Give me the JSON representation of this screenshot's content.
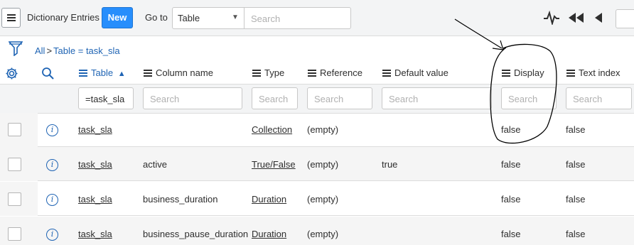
{
  "header": {
    "title": "Dictionary Entries",
    "new_label": "New",
    "goto_label": "Go to",
    "goto_select": "Table",
    "search_placeholder": "Search"
  },
  "breadcrumb": {
    "all": "All",
    "separator": ">",
    "filter": "Table = task_sla"
  },
  "columns": [
    {
      "label": "Table",
      "sorted": "asc"
    },
    {
      "label": "Column name"
    },
    {
      "label": "Type"
    },
    {
      "label": "Reference"
    },
    {
      "label": "Default value"
    },
    {
      "label": "Display"
    },
    {
      "label": "Text index"
    }
  ],
  "filters": [
    "=task_sla",
    "Search",
    "Search",
    "Search",
    "Search",
    "Search",
    "Search"
  ],
  "rows": [
    {
      "table": "task_sla",
      "column_name": "",
      "type": "Collection",
      "reference": "(empty)",
      "default_value": "",
      "display": "false",
      "text_index": "false"
    },
    {
      "table": "task_sla",
      "column_name": "active",
      "type": "True/False",
      "reference": "(empty)",
      "default_value": "true",
      "display": "false",
      "text_index": "false"
    },
    {
      "table": "task_sla",
      "column_name": "business_duration",
      "type": "Duration",
      "reference": "(empty)",
      "default_value": "",
      "display": "false",
      "text_index": "false"
    },
    {
      "table": "task_sla",
      "column_name": "business_pause_duration",
      "type": "Duration",
      "reference": "(empty)",
      "default_value": "",
      "display": "false",
      "text_index": "false"
    }
  ],
  "colors": {
    "accent": "#278efc",
    "link": "#1f64b4",
    "annotation": "#000000"
  }
}
